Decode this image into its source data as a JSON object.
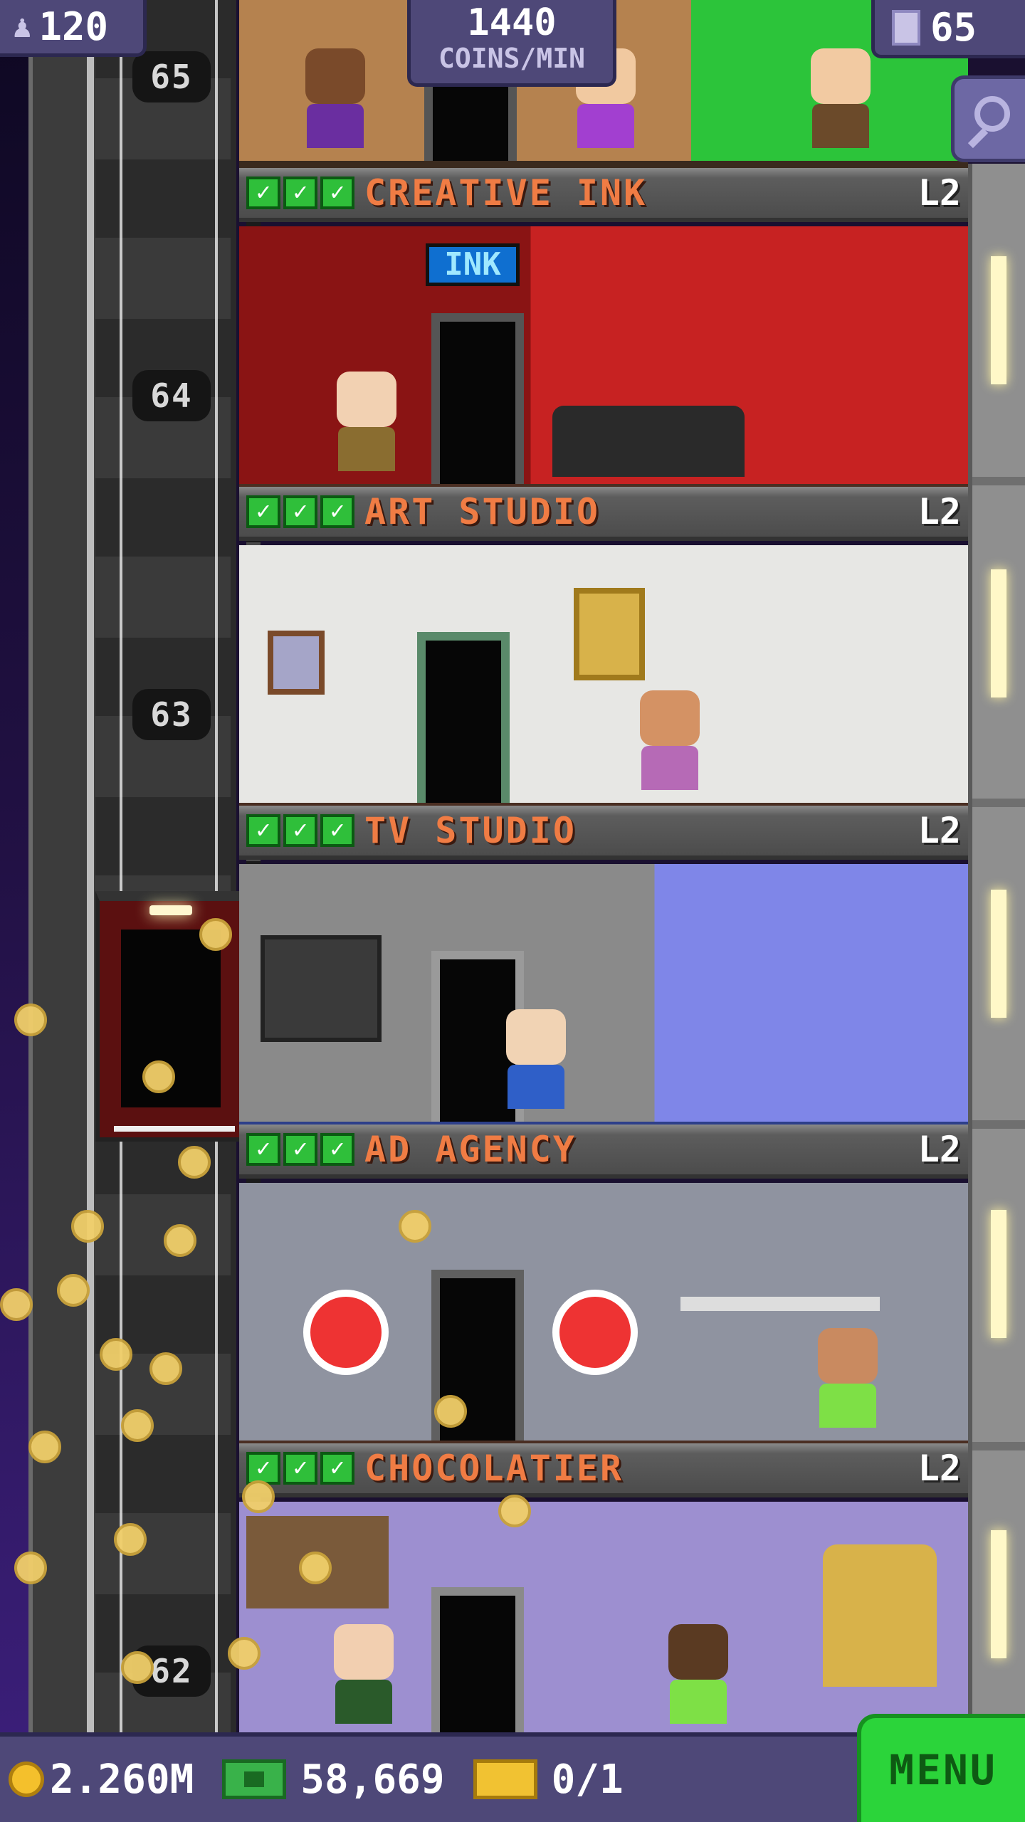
{
  "hud": {
    "population": "120",
    "coins_per_min_value": "1440",
    "coins_per_min_label": "COINS/MIN",
    "floor_count": "65"
  },
  "elevator": {
    "floor_numbers": [
      "65",
      "64",
      "63",
      "62"
    ]
  },
  "floors": [
    {
      "name": "CREATIVE INK",
      "level": "L2",
      "checks": 3
    },
    {
      "name": "ART STUDIO",
      "level": "L2",
      "checks": 3
    },
    {
      "name": "TV STUDIO",
      "level": "L2",
      "checks": 3
    },
    {
      "name": "AD AGENCY",
      "level": "L2",
      "checks": 3
    },
    {
      "name": "CHOCOLATIER",
      "level": "L2",
      "checks": 3
    }
  ],
  "signs": {
    "ink_sign": "INK"
  },
  "footer": {
    "coins": "2.260M",
    "bux": "58,669",
    "tickets": "0/1",
    "menu_label": "MENU"
  },
  "colors": {
    "hud_bg": "#4e4878",
    "floor_name": "#f07c44",
    "check_green": "#2fbf3a",
    "menu_green": "#2bd43a",
    "coin_gold": "#f4c02c"
  },
  "icons": [
    "person-icon",
    "building-icon",
    "search-icon",
    "checkmark-icon",
    "coin-icon",
    "bux-icon",
    "ticket-icon"
  ]
}
